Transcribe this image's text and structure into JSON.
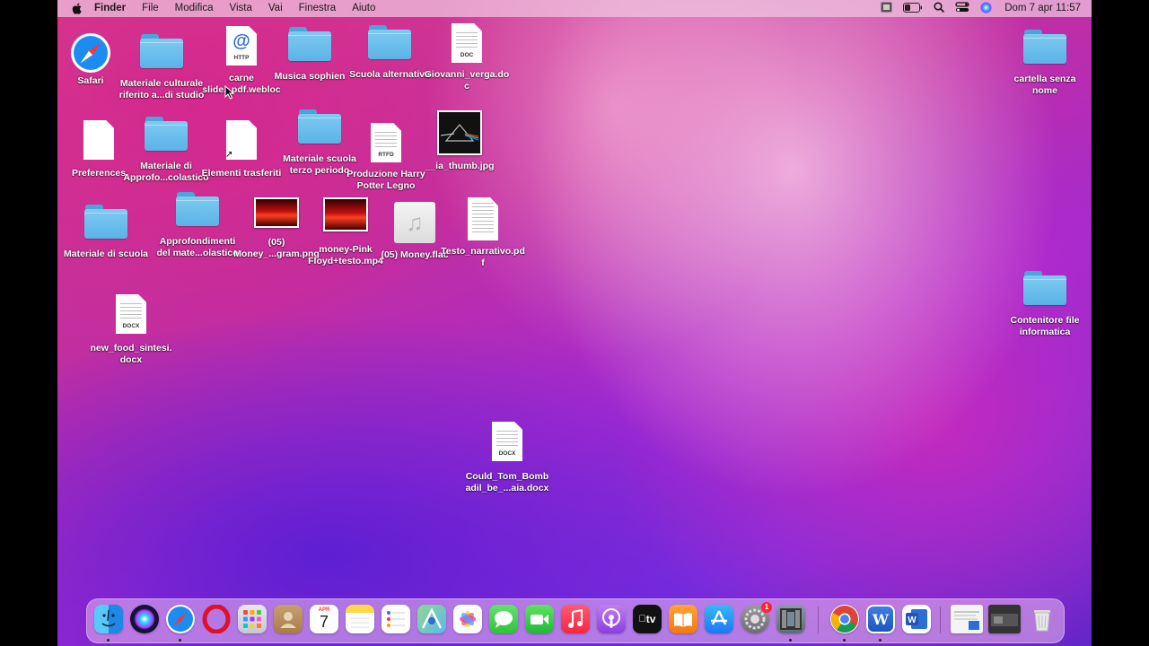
{
  "menubar": {
    "app": "Finder",
    "menus": [
      "File",
      "Modifica",
      "Vista",
      "Vai",
      "Finestra",
      "Aiuto"
    ],
    "datetime": "Dom 7 apr  11:57"
  },
  "desktop": {
    "safari": "Safari",
    "materiale_culturale": "Materiale culturale\nriferito a...di studio",
    "carne": "carne\nslide...pdf.webloc",
    "musica_sophien": "Musica sophien",
    "scuola_alternativa": "Scuola alternativa",
    "giovanni_verga": "Giovanni_verga.do\nc",
    "cartella_senza_nome": "cartella senza\nnome",
    "preferences": "Preferences",
    "materiale_approfo": "Materiale di\nApprofo...colastico",
    "elementi_trasferiti": "Elementi trasferiti",
    "materiale_scuola_terzo": "Materiale scuola\nterzo periodo",
    "produzione_harry": "Produzione Harry\nPotter Legno",
    "ia_thumb": "__ia_thumb.jpg",
    "materiale_di_scuola": "Materiale di scuola",
    "approfondimenti": "Approfondimenti\ndel mate...olastico",
    "money_gram": "(05)\nMoney_...gram.png",
    "money_pink": "money-Pink\nFloyd+testo.mp4",
    "money_flac": "(05) Money.flac",
    "testo_narrativo": "Testo_narrativo.pd\nf",
    "contenitore_file": "Contenitore file\ninformatica",
    "new_food": "new_food_sintesi.\ndocx",
    "could_tom": "Could_Tom_Bomb\nadil_be_...aia.docx"
  },
  "file_tags": {
    "http": "HTTP",
    "doc": "DOC",
    "rtfd": "RTFD",
    "docx": "DOCX"
  },
  "dock": {
    "calendar_month": "APR",
    "calendar_day": "7",
    "appletv": "tv",
    "settings_badge": "1"
  }
}
